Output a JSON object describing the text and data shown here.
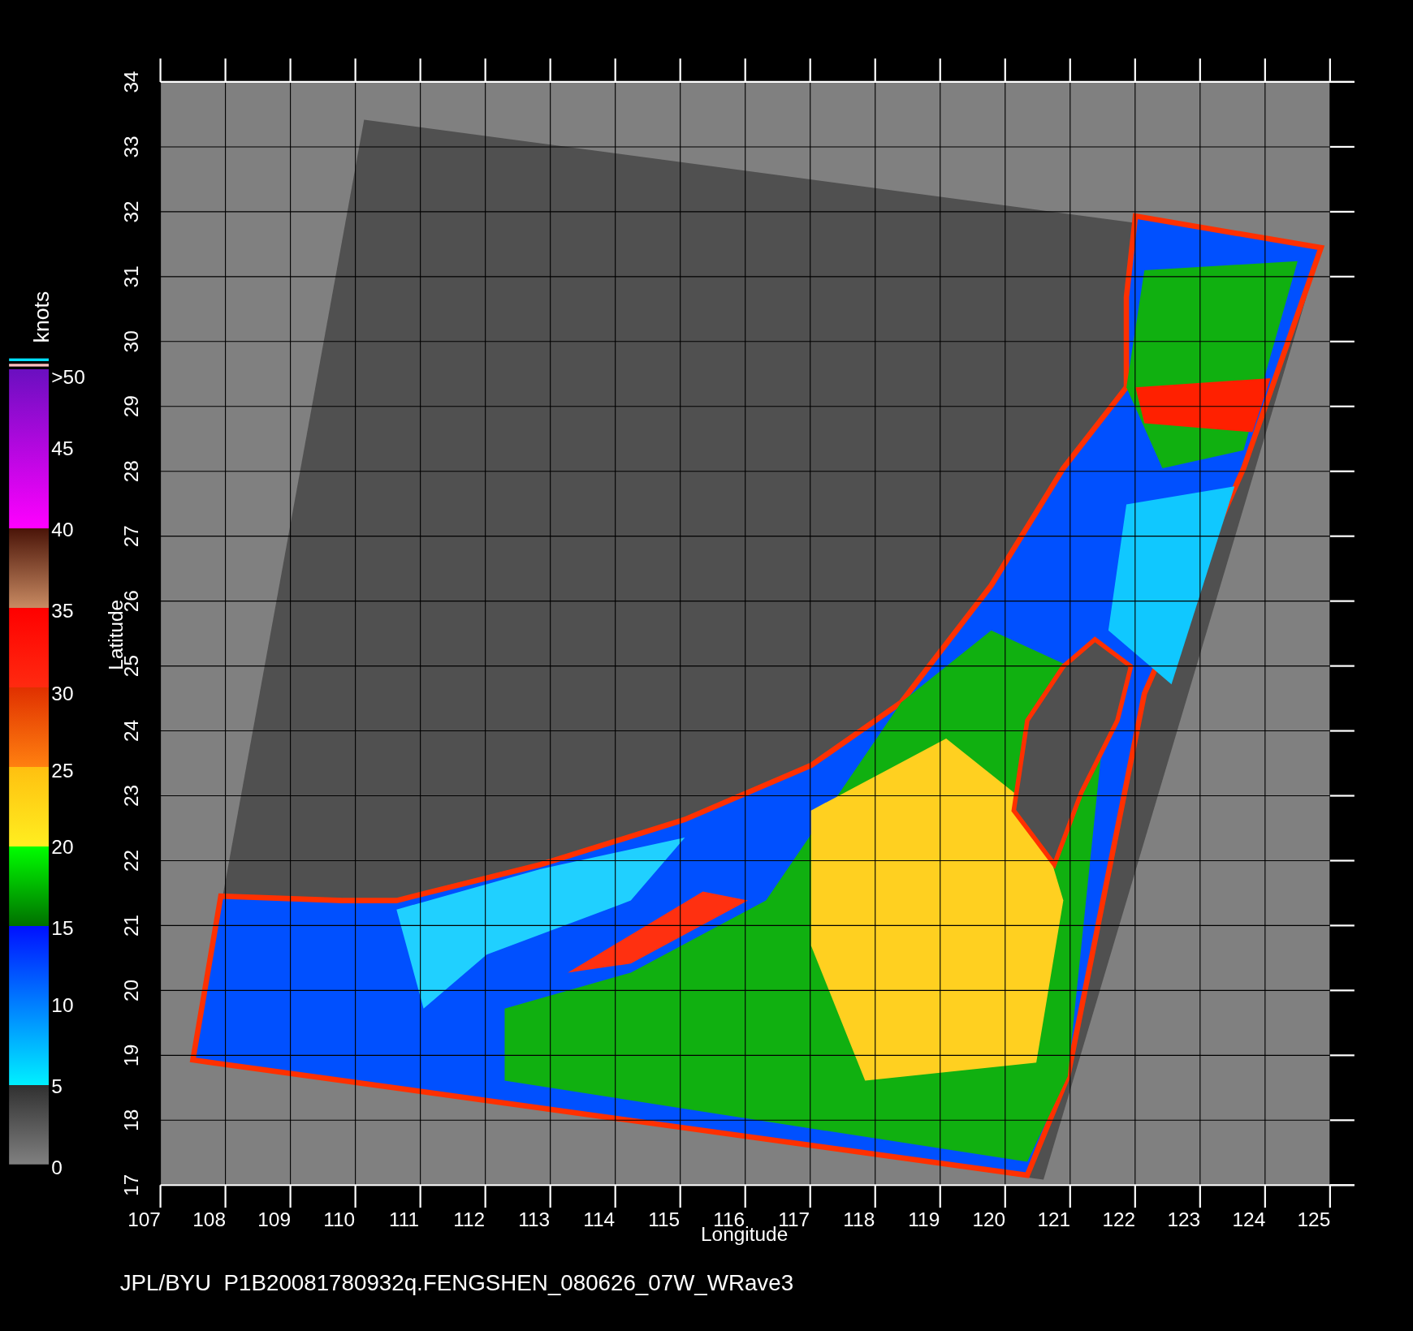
{
  "plot": {
    "xlabel": "Longitude",
    "ylabel": "Latitude",
    "xticks": [
      "107",
      "108",
      "109",
      "110",
      "111",
      "112",
      "113",
      "114",
      "115",
      "116",
      "117",
      "118",
      "119",
      "120",
      "121",
      "122",
      "123",
      "124",
      "125"
    ],
    "yticks": [
      "17",
      "18",
      "19",
      "20",
      "21",
      "22",
      "23",
      "24",
      "25",
      "26",
      "27",
      "28",
      "29",
      "30",
      "31",
      "32",
      "33",
      "34"
    ]
  },
  "colorbar": {
    "title": "knots",
    "labels": [
      ">50",
      "45",
      "40",
      "35",
      "30",
      "25",
      "20",
      "15",
      "10",
      "5",
      "0"
    ]
  },
  "caption": "JPL/BYU  P1B20081780932q.FENGSHEN_080626_07W_WRave3"
}
